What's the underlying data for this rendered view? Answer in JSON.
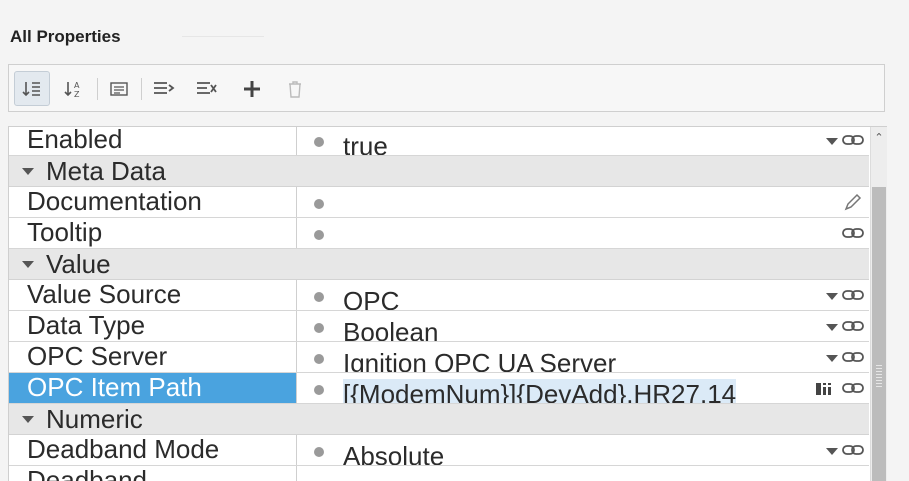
{
  "panel": {
    "title": "All Properties"
  },
  "toolbar": {
    "buttons": [
      {
        "name": "sort-by-category",
        "icon": "sort-category-icon",
        "active": true
      },
      {
        "name": "sort-alphabetical",
        "icon": "sort-az-icon"
      },
      {
        "name": "show-descriptions",
        "icon": "list-detail-icon"
      },
      {
        "name": "expand-all",
        "icon": "expand-all-icon"
      },
      {
        "name": "collapse-all",
        "icon": "collapse-all-icon"
      },
      {
        "name": "add-property",
        "icon": "plus-icon"
      },
      {
        "name": "delete-property",
        "icon": "trash-icon",
        "disabled": true
      }
    ]
  },
  "grid": {
    "rows": {
      "enabled": {
        "name": "Enabled",
        "value": "true"
      },
      "meta_group": "Meta Data",
      "documentation": {
        "name": "Documentation",
        "value": ""
      },
      "tooltip": {
        "name": "Tooltip",
        "value": ""
      },
      "value_group": "Value",
      "value_source": {
        "name": "Value Source",
        "value": "OPC"
      },
      "data_type": {
        "name": "Data Type",
        "value": "Boolean"
      },
      "opc_server": {
        "name": "OPC Server",
        "value": "Ignition OPC UA Server"
      },
      "opc_item_path": {
        "name": "OPC Item Path",
        "value": "[{ModemNum}]{DevAdd}.HR27.14"
      },
      "numeric_group": "Numeric",
      "deadband_mode": {
        "name": "Deadband Mode",
        "value": "Absolute"
      },
      "deadband": {
        "name": "Deadband",
        "value": ""
      }
    }
  },
  "colors": {
    "selection": "#4aa3df",
    "group_bg": "#e7e7e7",
    "value_highlight": "#dbeaf7"
  }
}
